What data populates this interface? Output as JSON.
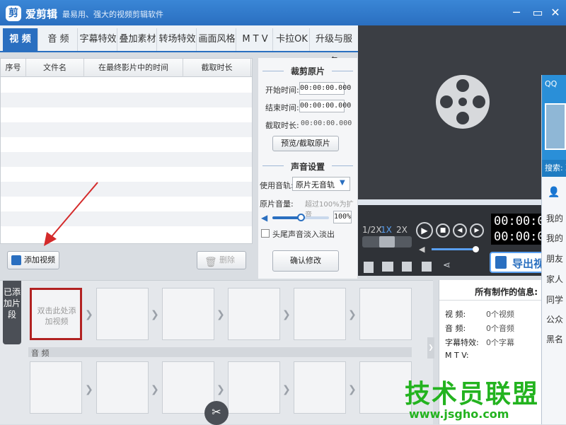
{
  "titlebar": {
    "logo": "剪",
    "app_name": "爱剪辑",
    "slogan": "最易用、强大的视频剪辑软件"
  },
  "tabs": [
    {
      "label": "视 频",
      "active": true
    },
    {
      "label": "音 频",
      "active": false
    },
    {
      "label": "字幕特效",
      "active": false
    },
    {
      "label": "叠加素材",
      "active": false
    },
    {
      "label": "转场特效",
      "active": false
    },
    {
      "label": "画面风格",
      "active": false
    },
    {
      "label": "M T V",
      "active": false
    },
    {
      "label": "卡拉OK",
      "active": false
    },
    {
      "label": "升级与服务",
      "active": false
    }
  ],
  "file_table": {
    "columns": [
      "序号",
      "文件名",
      "在最终影片中的时间",
      "截取时长"
    ],
    "rows": []
  },
  "file_actions": {
    "add_video": "添加视频",
    "delete": "删除"
  },
  "trim": {
    "title": "裁剪原片",
    "start_label": "开始时间:",
    "start_value": "00:00:00.000",
    "end_label": "结束时间:",
    "end_value": "00:00:00.000",
    "duration_label": "截取时长:",
    "duration_value": "00:00:00.000",
    "preview_button": "预览/截取原片"
  },
  "audio": {
    "title": "声音设置",
    "track_label": "使用音轨:",
    "track_value": "原片无音轨",
    "volume_label": "原片音量:",
    "volume_hint": "超过100%为扩音",
    "volume_value": "100%",
    "fade_label": "头尾声音淡入淡出",
    "confirm_button": "确认修改"
  },
  "player": {
    "speeds": [
      "1/2X",
      "1X",
      "2X"
    ],
    "timecode_top": "00:00:00.",
    "timecode_bottom": "00:00:00.",
    "export_button": "导出视"
  },
  "timeline": {
    "side_tab": "已添加片段",
    "first_slot_text": "双击此处添加视频",
    "audio_label": "音 频"
  },
  "info": {
    "title": "所有制作的信息:",
    "rows": [
      {
        "label": "视    频:",
        "value": "0个视频"
      },
      {
        "label": "音    频:",
        "value": "0个音频"
      },
      {
        "label": "字幕特效:",
        "value": "0个字幕"
      },
      {
        "label": "M  T  V:",
        "value": ""
      }
    ]
  },
  "qq": {
    "title": "QQ",
    "search": "搜索: 联",
    "items": [
      "我的",
      "我的",
      "朋友",
      "家人",
      "同学",
      "公众",
      "黑名"
    ]
  },
  "watermark": {
    "title": "技术员联盟",
    "url": "www.jsgho.com"
  },
  "colors": {
    "accent": "#2a6fc0",
    "highlight_border": "#b22222",
    "watermark": "#23b31f"
  }
}
